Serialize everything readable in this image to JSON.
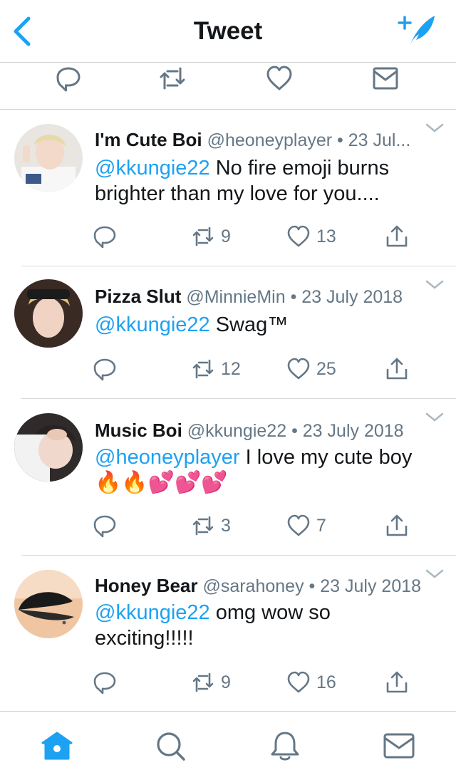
{
  "nav": {
    "title": "Tweet"
  },
  "colors": {
    "accent": "#1da1f2",
    "gray": "#657786",
    "text": "#14171a",
    "divider": "#cfd3d6"
  },
  "top_actions": [
    "reply-icon",
    "retweet-icon",
    "like-icon",
    "message-icon"
  ],
  "tweets": [
    {
      "name": "I'm Cute Boi",
      "handle": "@heoneyplayer",
      "dot": "•",
      "time": "23 Jul...",
      "mention": "@kkungie22",
      "text": " No fire emoji burns brighter than my love for you....",
      "emojis": "",
      "retweets": "9",
      "likes": "13"
    },
    {
      "name": "Pizza Slut",
      "handle": "@MinnieMin",
      "dot": "•",
      "time": "23 July 2018",
      "mention": "@kkungie22",
      "text": " Swag™",
      "emojis": "",
      "retweets": "12",
      "likes": "25"
    },
    {
      "name": "Music Boi",
      "handle": "@kkungie22",
      "dot": "•",
      "time": "23 July 2018",
      "mention": "@heoneyplayer",
      "text": " I love my cute boy",
      "emojis": "🔥🔥💕💕💕",
      "retweets": "3",
      "likes": "7"
    },
    {
      "name": "Honey Bear",
      "handle": "@sarahoney",
      "dot": "•",
      "time": "23 July 2018",
      "mention": "@kkungie22",
      "text": " omg wow so exciting!!!!!",
      "emojis": "",
      "retweets": "9",
      "likes": "16"
    }
  ],
  "tabbar": [
    "home-icon",
    "search-icon",
    "notifications-icon",
    "messages-icon"
  ]
}
